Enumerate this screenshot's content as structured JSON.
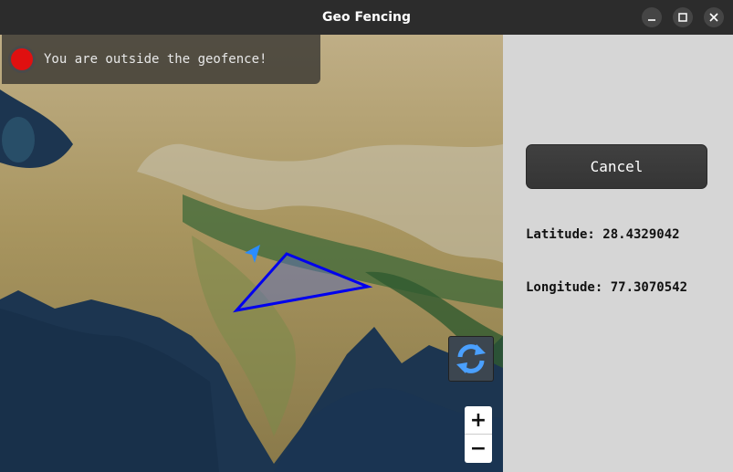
{
  "window": {
    "title": "Geo Fencing"
  },
  "status": {
    "text": "You are outside the geofence!",
    "indicator_color": "#e01010"
  },
  "map": {
    "zoom_in_label": "+",
    "zoom_out_label": "−",
    "geofence_color": "#0000ee"
  },
  "side_panel": {
    "cancel_label": "Cancel",
    "latitude_text": "Latitude: 28.4329042",
    "longitude_text": "Longitude: 77.3070542"
  }
}
